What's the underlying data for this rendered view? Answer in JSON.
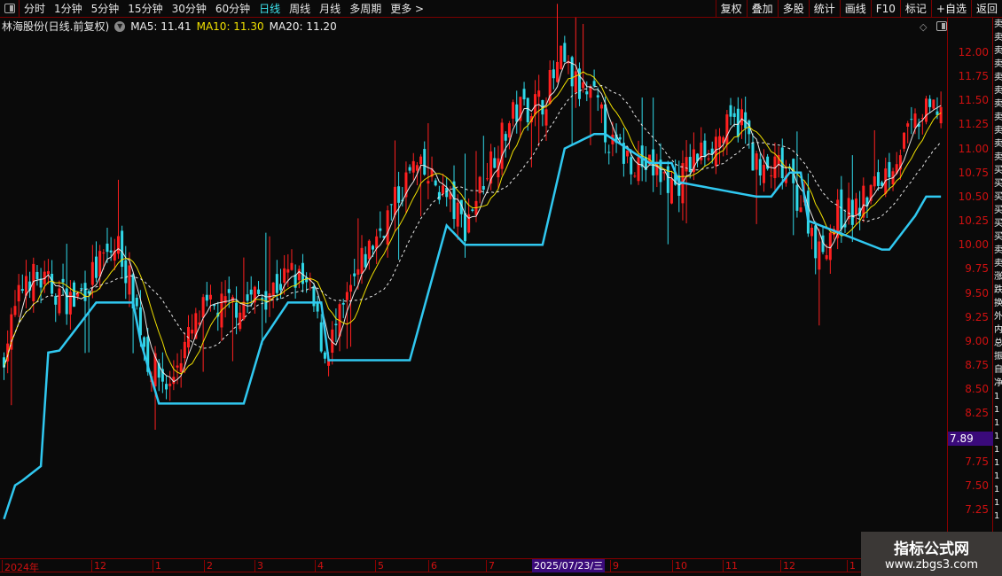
{
  "toolbar": {
    "periods": [
      "分时",
      "1分钟",
      "5分钟",
      "15分钟",
      "30分钟",
      "60分钟",
      "日线",
      "周线",
      "月线",
      "多周期",
      "更多 >"
    ],
    "active": "日线",
    "right_buttons": [
      "复权",
      "叠加",
      "多股",
      "统计",
      "画线",
      "F10",
      "标记",
      "+自选",
      "返回"
    ]
  },
  "title": {
    "name": "林海股份(日线.前复权)",
    "ma5": "MA5: 11.41",
    "ma10": "MA10: 11.30",
    "ma20": "MA20: 11.20"
  },
  "price_axis": {
    "ticks": [
      "12.00",
      "11.75",
      "11.50",
      "11.25",
      "11.00",
      "10.75",
      "10.50",
      "10.25",
      "10.00",
      "9.75",
      "9.50",
      "9.25",
      "9.00",
      "8.75",
      "8.50",
      "8.25",
      "7.75",
      "7.50",
      "7.25"
    ],
    "current": "7.89"
  },
  "date_axis": {
    "labels": [
      "2024年",
      "12",
      "1",
      "2",
      "3",
      "4",
      "5",
      "6",
      "7",
      "9",
      "10",
      "11",
      "12",
      "1"
    ],
    "highlight": "2025/07/23/三"
  },
  "watermark": {
    "line1": "指标公式网",
    "line2": "www.zbgs3.com"
  },
  "colors": {
    "up": "#ff2020",
    "down": "#30d8e8",
    "ma10": "#f0e000",
    "stop_line": "#30c8f0"
  },
  "chart_data": {
    "type": "candlestick",
    "ylim": [
      7.1,
      12.2
    ],
    "close_path_days": [
      0,
      6,
      13,
      19,
      26,
      31,
      35,
      39,
      45,
      47,
      54,
      64,
      71,
      78,
      83,
      87,
      92,
      97,
      104,
      111,
      118,
      123,
      125,
      132,
      139,
      146,
      151,
      156,
      160,
      165,
      170,
      175,
      182,
      186,
      193,
      200,
      205,
      210,
      217,
      221,
      226,
      231,
      238,
      248,
      254
    ],
    "close_path": [
      8.9,
      9.7,
      9.55,
      9.4,
      9.8,
      10.0,
      9.5,
      8.8,
      8.5,
      8.8,
      9.3,
      9.4,
      9.5,
      9.7,
      9.5,
      8.85,
      9.3,
      9.8,
      10.3,
      10.8,
      10.6,
      10.3,
      10.2,
      10.9,
      11.4,
      11.5,
      11.9,
      11.6,
      11.5,
      11.0,
      10.9,
      10.8,
      10.6,
      10.85,
      11.1,
      11.3,
      10.7,
      10.8,
      10.4,
      9.9,
      10.3,
      10.35,
      10.7,
      11.3,
      11.45
    ],
    "stop_line_days": [
      0,
      3,
      5,
      10,
      12,
      15,
      23,
      25,
      35,
      37,
      42,
      65,
      70,
      77,
      86,
      88,
      110,
      120,
      125,
      146,
      152,
      160,
      163,
      175,
      181,
      183,
      204,
      208,
      213,
      216,
      218,
      238,
      240,
      247,
      250
    ],
    "stop_line": [
      7.15,
      7.5,
      7.55,
      7.7,
      8.88,
      8.9,
      9.3,
      9.4,
      9.4,
      9.0,
      8.35,
      8.35,
      9.0,
      9.4,
      9.4,
      8.8,
      8.8,
      10.2,
      10.0,
      10.0,
      11.0,
      11.15,
      11.15,
      10.85,
      10.85,
      10.65,
      10.5,
      10.5,
      10.75,
      10.75,
      10.25,
      9.95,
      9.95,
      10.3,
      10.5
    ],
    "series": [
      "MA5",
      "MA10",
      "MA20"
    ]
  }
}
